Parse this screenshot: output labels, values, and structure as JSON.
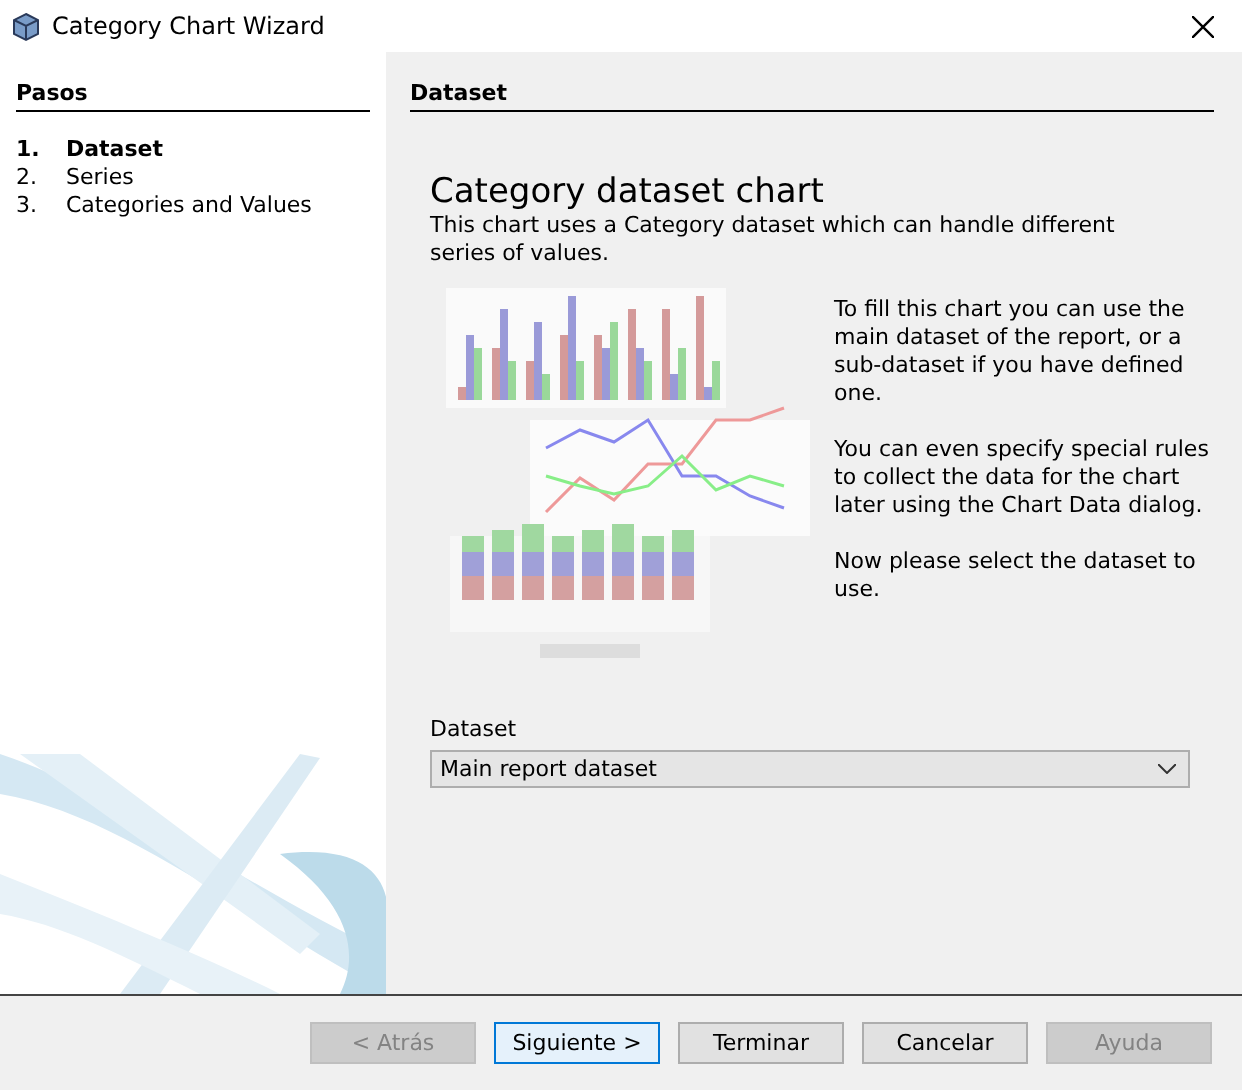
{
  "window": {
    "title": "Category Chart Wizard"
  },
  "steps": {
    "title": "Pasos",
    "items": [
      {
        "number": "1.",
        "label": "Dataset",
        "selected": true
      },
      {
        "number": "2.",
        "label": "Series",
        "selected": false
      },
      {
        "number": "3.",
        "label": "Categories and Values",
        "selected": false
      }
    ]
  },
  "panel": {
    "header": "Dataset",
    "title": "Category dataset chart",
    "description": "This chart uses a Category dataset which can handle different series of values.",
    "paragraphs": [
      "To fill this chart you can use the main dataset of the report, or a sub-dataset if you have defined one.",
      "You can even specify special rules to collect the data for the chart later using the Chart Data dialog.",
      "Now please select the dataset to use."
    ],
    "dataset_label": "Dataset",
    "dataset_value": "Main report dataset"
  },
  "buttons": [
    {
      "label": "< Atrás",
      "disabled": true,
      "focused": false
    },
    {
      "label": "Siguiente >",
      "disabled": false,
      "focused": true
    },
    {
      "label": "Terminar",
      "disabled": false,
      "focused": false
    },
    {
      "label": "Cancelar",
      "disabled": false,
      "focused": false
    },
    {
      "label": "Ayuda",
      "disabled": true,
      "focused": false
    }
  ]
}
